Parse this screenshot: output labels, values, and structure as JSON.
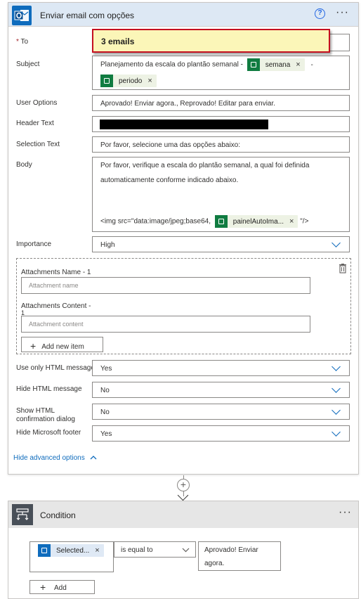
{
  "action": {
    "title": "Enviar email com opções",
    "help_icon": "?",
    "more_icon": "···"
  },
  "tooltip": {
    "text": "3 emails"
  },
  "fields": {
    "to": {
      "label": "To",
      "required_mark": "*"
    },
    "subject": {
      "label": "Subject",
      "text": "Planejamento da escala do plantão semanal -",
      "token1": "semana",
      "sep": "-",
      "token2": "periodo"
    },
    "user_options": {
      "label": "User Options",
      "value": "Aprovado! Enviar agora., Reprovado! Editar para enviar."
    },
    "header_text": {
      "label": "Header Text"
    },
    "selection_text": {
      "label": "Selection Text",
      "value": "Por favor, selecione uma das opções abaixo:"
    },
    "body": {
      "label": "Body",
      "line1": "Por favor, verifique a escala do plantão semanal, a qual foi definida",
      "line2": "automaticamente conforme indicado abaixo.",
      "img_prefix": "<img src=\"data:image/jpeg;base64,",
      "token": "painelAutoIma...",
      "img_suffix": "\"/>"
    },
    "importance": {
      "label": "Importance",
      "value": "High"
    },
    "attachments": {
      "name_label": "Attachments Name - 1",
      "name_placeholder": "Attachment name",
      "content_label": "Attachments Content -",
      "content_label_2": "1",
      "content_placeholder": "Attachment content",
      "add_new_item": "Add new item"
    },
    "use_only_html": {
      "label": "Use only HTML message",
      "value": "Yes"
    },
    "hide_html": {
      "label": "Hide HTML message",
      "value": "No"
    },
    "show_html_conf": {
      "label_1": "Show HTML",
      "label_2": "confirmation dialog",
      "value": "No"
    },
    "hide_ms_footer": {
      "label": "Hide Microsoft footer",
      "value": "Yes"
    }
  },
  "hide_advanced": "Hide advanced options",
  "connector": {
    "plus": "+"
  },
  "condition": {
    "title": "Condition",
    "more_icon": "···",
    "left_token": "Selected...",
    "operator": "is equal to",
    "right_line1": "Aprovado! Enviar",
    "right_line2": "agora.",
    "add_button": "Add"
  },
  "colors": {
    "accent": "#0f6cbd",
    "excel_green": "#107c41",
    "token_bg": "#edf2e4",
    "tooltip_bg": "#fbf6b8",
    "tooltip_border": "#c50f1f"
  }
}
